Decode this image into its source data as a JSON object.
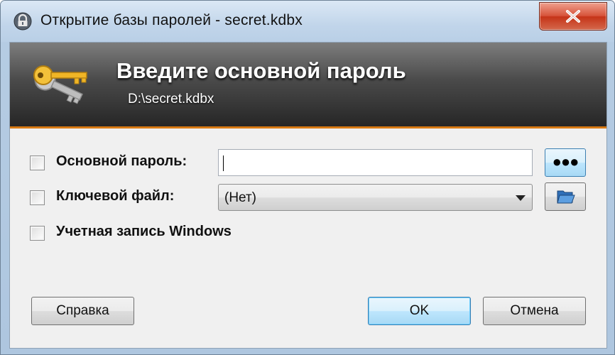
{
  "window": {
    "title": "Открытие базы паролей - secret.kdbx",
    "close_icon": "close-icon"
  },
  "banner": {
    "title": "Введите основной пароль",
    "subtitle": "D:\\secret.kdbx",
    "icon": "key-icon"
  },
  "fields": {
    "master_password": {
      "label": "Основной пароль:",
      "checked": false,
      "value": "",
      "reveal_button_label": "●●●"
    },
    "key_file": {
      "label": "Ключевой файл:",
      "checked": false,
      "selected": "(Нет)",
      "browse_icon": "folder-open-icon"
    },
    "windows_account": {
      "label": "Учетная запись Windows",
      "checked": false
    }
  },
  "buttons": {
    "help": "Справка",
    "ok": "OK",
    "cancel": "Отмена"
  },
  "colors": {
    "banner_accent": "#d87a14",
    "default_button_border": "#3c7fb1"
  }
}
